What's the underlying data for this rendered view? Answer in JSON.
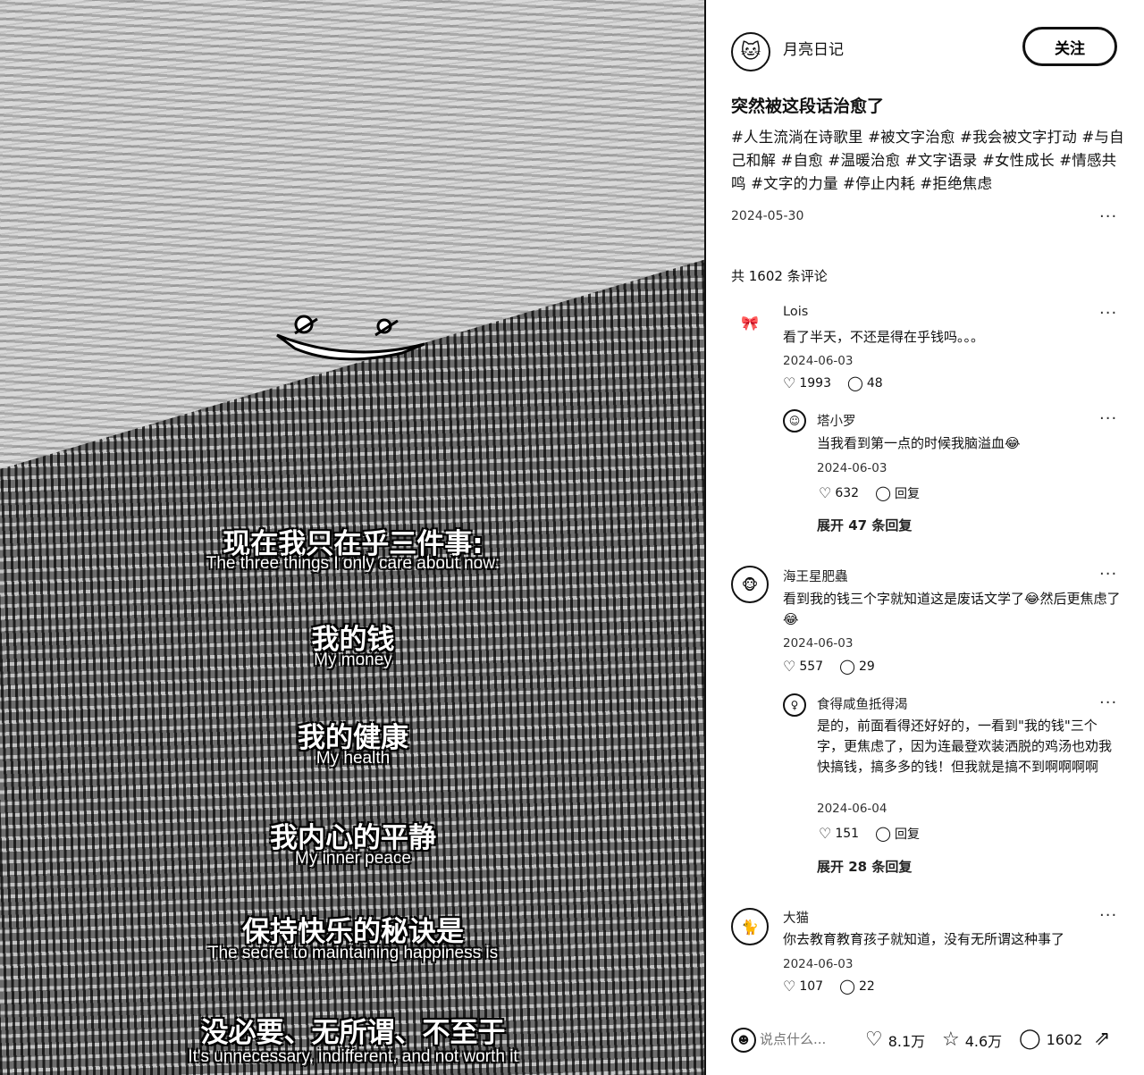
{
  "image": {
    "lines": [
      {
        "zh": "现在我只在乎三件事:",
        "en": "The three things I only care about now:"
      },
      {
        "zh": "我的钱",
        "en": "My money"
      },
      {
        "zh": "我的健康",
        "en": "My health"
      },
      {
        "zh": "我内心的平静",
        "en": "My inner peace"
      },
      {
        "zh": "保持快乐的秘诀是",
        "en": "The secret to maintaining happiness is"
      },
      {
        "zh": "没必要、无所谓、不至于",
        "en": "It's unnecessary, indifferent, and not worth it"
      }
    ]
  },
  "author": {
    "name": "月亮日记",
    "follow_label": "关注"
  },
  "post": {
    "title": "突然被这段话治愈了",
    "tags": "#人生流淌在诗歌里 #被文字治愈 #我会被文字打动 #与自己和解 #自愈 #温暖治愈 #文字语录 #女性成长 #情感共鸣 #文字的力量 #停止内耗 #拒绝焦虑",
    "date": "2024-05-30",
    "more": "···"
  },
  "comments_header": "共 1602 条评论",
  "comments": [
    {
      "name": "Lois",
      "text": "看了半天，不还是得在乎钱吗。。。",
      "date": "2024-06-03",
      "likes": "1993",
      "replies": "48",
      "more": "···"
    },
    {
      "name": "塔小罗",
      "text": "当我看到第一点的时候我脑溢血😂",
      "date": "2024-06-03",
      "likes": "632",
      "replies": "回复",
      "more": "···"
    },
    {
      "expand": "展开 47 条回复"
    },
    {
      "name": "海王星肥蟲",
      "text": "看到我的钱三个字就知道这是废话文学了😂然后更焦虑了😂",
      "date": "2024-06-03",
      "likes": "557",
      "replies": "29",
      "more": "···"
    },
    {
      "name": "食得咸鱼抵得渴",
      "text": "是的，前面看得还好好的，一看到\"我的钱\"三个字，更焦虑了，因为连最登欢装洒脱的鸡汤也劝我快搞钱，搞多多的钱！但我就是搞不到啊啊啊啊",
      "date": "2024-06-04",
      "likes": "151",
      "replies": "回复",
      "more": "···"
    },
    {
      "expand": "展开 28 条回复"
    },
    {
      "name": "大猫",
      "text": "你去教育教育孩子就知道，没有无所谓这种事了",
      "date": "2024-06-03",
      "likes": "107",
      "replies": "22",
      "more": "···"
    }
  ],
  "bottom_bar": {
    "placeholder": "说点什么...",
    "likes": "8.1万",
    "stars": "4.6万",
    "comments": "1602"
  },
  "icons": {
    "heart": "heart-icon",
    "comment": "comment-icon",
    "star": "star-icon",
    "share": "share-icon"
  }
}
